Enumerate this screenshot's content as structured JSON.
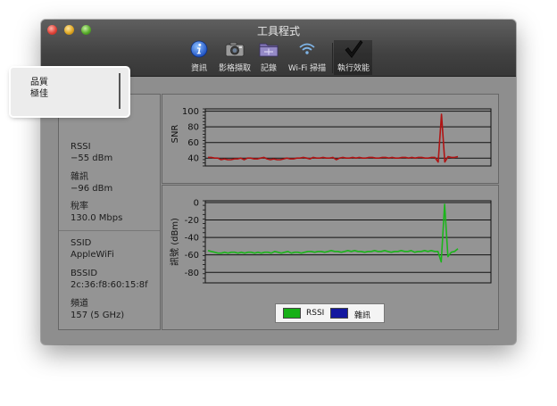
{
  "window": {
    "title": "工具程式"
  },
  "toolbar": {
    "items": [
      {
        "label": "資訊",
        "icon": "info-icon"
      },
      {
        "label": "影格擷取",
        "icon": "camera-icon"
      },
      {
        "label": "記錄",
        "icon": "folder-icon"
      },
      {
        "label": "Wi-Fi 掃描",
        "icon": "wifi-icon"
      },
      {
        "label": "執行效能",
        "icon": "checkmark-icon"
      }
    ]
  },
  "info": {
    "quality": {
      "label": "品質",
      "value": "極佳"
    },
    "rssi": {
      "label": "RSSI",
      "value": "−55 dBm"
    },
    "noise": {
      "label": "雜訊",
      "value": "−96 dBm"
    },
    "rate": {
      "label": "稅率",
      "value": "130.0 Mbps"
    },
    "ssid": {
      "label": "SSID",
      "value": "AppleWiFi"
    },
    "bssid": {
      "label": "BSSID",
      "value": "2c:36:f8:60:15:8f"
    },
    "channel": {
      "label": "頻道",
      "value": "157 (5 GHz)"
    }
  },
  "chart_data": [
    {
      "type": "line",
      "ylabel": "SNR",
      "yticks": [
        100,
        80,
        60,
        40
      ],
      "ylim": [
        30,
        103
      ],
      "series": [
        {
          "color": "#b01414",
          "values": [
            41,
            41,
            40,
            40,
            38,
            39,
            38,
            38,
            39,
            39,
            40,
            38,
            40,
            40,
            39,
            39,
            40,
            41,
            39,
            38,
            39,
            38,
            38,
            39,
            40,
            39,
            39,
            40,
            40,
            41,
            40,
            39,
            41,
            40,
            40,
            41,
            40,
            40,
            41,
            38,
            40,
            41,
            40,
            40,
            41,
            40,
            41,
            40,
            40,
            41,
            41,
            40,
            40,
            41,
            41,
            40,
            41,
            40,
            40,
            41,
            41,
            40,
            41,
            40,
            41,
            41,
            40,
            40,
            41,
            41,
            35,
            96,
            35,
            42,
            41,
            41,
            42
          ]
        }
      ]
    },
    {
      "type": "line",
      "ylabel": "訊號 (dBm)",
      "yticks": [
        0,
        -20,
        -40,
        -60,
        -80
      ],
      "ylim": [
        -92,
        2
      ],
      "series": [
        {
          "name": "RSSI",
          "color": "#1bb51b",
          "values": [
            -55,
            -56,
            -57,
            -58,
            -58,
            -57,
            -58,
            -57,
            -57,
            -58,
            -57,
            -58,
            -57,
            -57,
            -58,
            -57,
            -58,
            -57,
            -57,
            -58,
            -56,
            -57,
            -58,
            -57,
            -56,
            -58,
            -57,
            -57,
            -58,
            -57,
            -56,
            -56,
            -57,
            -56,
            -56,
            -57,
            -56,
            -55,
            -56,
            -56,
            -57,
            -56,
            -55,
            -56,
            -55,
            -56,
            -56,
            -57,
            -56,
            -56,
            -55,
            -56,
            -56,
            -55,
            -56,
            -57,
            -56,
            -56,
            -55,
            -56,
            -56,
            -55,
            -57,
            -56,
            -56,
            -55,
            -56,
            -55,
            -56,
            -56,
            -68,
            -2,
            -62,
            -57,
            -56,
            -53
          ]
        },
        {
          "name": "雜訊",
          "color": "#1624a6",
          "values": []
        }
      ]
    }
  ],
  "legend": [
    {
      "label": "RSSI",
      "color": "#17b017"
    },
    {
      "label": "雜訊",
      "color": "#13189f"
    }
  ]
}
